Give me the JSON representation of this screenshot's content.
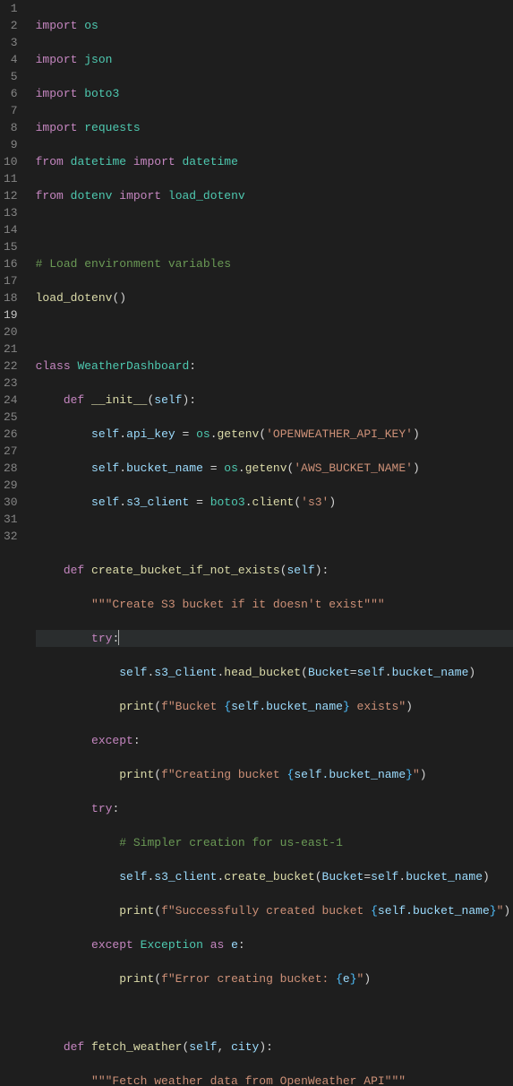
{
  "colors": {
    "bg": "#1e1e1e",
    "fg": "#d4d4d4",
    "gutter": "#858585",
    "keyword": "#c586c0",
    "type": "#4ec9b0",
    "func": "#dcdcaa",
    "string": "#ce9178",
    "comment": "#6a9955",
    "variable": "#9cdcfe"
  },
  "active_line": 19,
  "lines": {
    "l1_import": "import",
    "l1_os": "os",
    "l2_import": "import",
    "l2_json": "json",
    "l3_import": "import",
    "l3_boto3": "boto3",
    "l4_import": "import",
    "l4_requests": "requests",
    "l5_from": "from",
    "l5_datetime1": "datetime",
    "l5_import": "import",
    "l5_datetime2": "datetime",
    "l6_from": "from",
    "l6_dotenv": "dotenv",
    "l6_import": "import",
    "l6_load_dotenv": "load_dotenv",
    "l8_comment": "# Load environment variables",
    "l9_load_dotenv": "load_dotenv",
    "l11_class": "class",
    "l11_name": "WeatherDashboard",
    "l12_def": "def",
    "l12_init": "__init__",
    "l12_self": "self",
    "l13_self": "self",
    "l13_api_key": "api_key",
    "l13_os": "os",
    "l13_getenv": "getenv",
    "l13_str": "'OPENWEATHER_API_KEY'",
    "l14_self": "self",
    "l14_bucket_name": "bucket_name",
    "l14_os": "os",
    "l14_getenv": "getenv",
    "l14_str": "'AWS_BUCKET_NAME'",
    "l15_self": "self",
    "l15_s3_client": "s3_client",
    "l15_boto3": "boto3",
    "l15_client": "client",
    "l15_str": "'s3'",
    "l17_def": "def",
    "l17_name": "create_bucket_if_not_exists",
    "l17_self": "self",
    "l18_doc": "\"\"\"Create S3 bucket if it doesn't exist\"\"\"",
    "l19_try": "try",
    "l20_self": "self",
    "l20_s3_client": "s3_client",
    "l20_head_bucket": "head_bucket",
    "l20_Bucket": "Bucket",
    "l20_self2": "self",
    "l20_bucket_name": "bucket_name",
    "l21_print": "print",
    "l21_f": "f\"Bucket ",
    "l21_open": "{",
    "l21_self": "self",
    "l21_bucket_name": ".bucket_name",
    "l21_close": "}",
    "l21_end": " exists\"",
    "l22_except": "except",
    "l23_print": "print",
    "l23_f": "f\"Creating bucket ",
    "l23_open": "{",
    "l23_self": "self",
    "l23_bucket_name": ".bucket_name",
    "l23_close": "}",
    "l23_end": "\"",
    "l24_try": "try",
    "l25_comment": "# Simpler creation for us-east-1",
    "l26_self": "self",
    "l26_s3_client": "s3_client",
    "l26_create_bucket": "create_bucket",
    "l26_Bucket": "Bucket",
    "l26_self2": "self",
    "l26_bucket_name": "bucket_name",
    "l27_print": "print",
    "l27_f": "f\"Successfully created bucket ",
    "l27_open": "{",
    "l27_self": "self",
    "l27_bucket_name": ".bucket_name",
    "l27_close": "}",
    "l27_end": "\"",
    "l28_except": "except",
    "l28_Exception": "Exception",
    "l28_as": "as",
    "l28_e": "e",
    "l29_print": "print",
    "l29_f": "f\"Error creating bucket: ",
    "l29_open": "{",
    "l29_e": "e",
    "l29_close": "}",
    "l29_end": "\"",
    "l31_def": "def",
    "l31_name": "fetch_weather",
    "l31_self": "self",
    "l31_city": "city",
    "l32_doc": "\"\"\"Fetch weather data from OpenWeather API\"\"\""
  },
  "gutter": [
    "1",
    "2",
    "3",
    "4",
    "5",
    "6",
    "7",
    "8",
    "9",
    "10",
    "11",
    "12",
    "13",
    "14",
    "15",
    "16",
    "17",
    "18",
    "19",
    "20",
    "21",
    "22",
    "23",
    "24",
    "25",
    "26",
    "27",
    "28",
    "29",
    "30",
    "31",
    "32"
  ]
}
